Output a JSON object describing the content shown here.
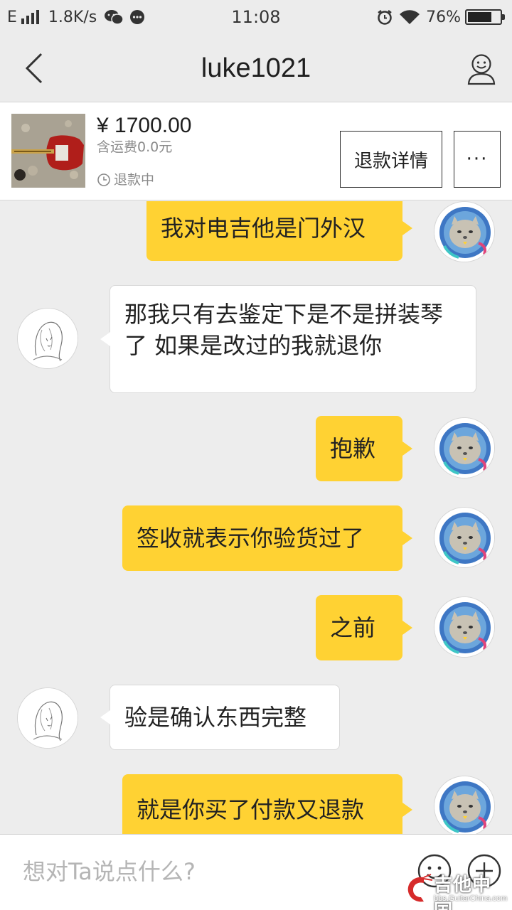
{
  "status_bar": {
    "network": "E",
    "speed": "1.8K/s",
    "time": "11:08",
    "battery": "76%",
    "battery_level": 0.76
  },
  "header": {
    "title": "luke1021",
    "back_icon": "chevron-left-icon",
    "profile_icon": "user-icon"
  },
  "product": {
    "price": "¥ 1700.00",
    "shipping": "含运费0.0元",
    "status": "退款中",
    "detail_button": "退款详情",
    "more_button": "···"
  },
  "messages": [
    {
      "side": "me",
      "text": "我对电吉他是门外汉"
    },
    {
      "side": "them",
      "text": "那我只有去鉴定下是不是拼装琴了  如果是改过的我就退你"
    },
    {
      "side": "me",
      "text": "抱歉"
    },
    {
      "side": "me",
      "text": "签收就表示你验货过了"
    },
    {
      "side": "me",
      "text": "之前"
    },
    {
      "side": "them",
      "text": "验是确认东西完整"
    },
    {
      "side": "me",
      "text": "就是你买了付款又退款"
    }
  ],
  "input": {
    "placeholder": "想对Ta说点什么?",
    "emoji_icon": "smiley-icon",
    "plus_icon": "plus-icon"
  },
  "watermark": {
    "text": "吉他中国",
    "sub": "bbs.GuitarChina.com"
  },
  "colors": {
    "my_bubble": "#ffd233",
    "their_bubble": "#ffffff",
    "background": "#ededed"
  }
}
